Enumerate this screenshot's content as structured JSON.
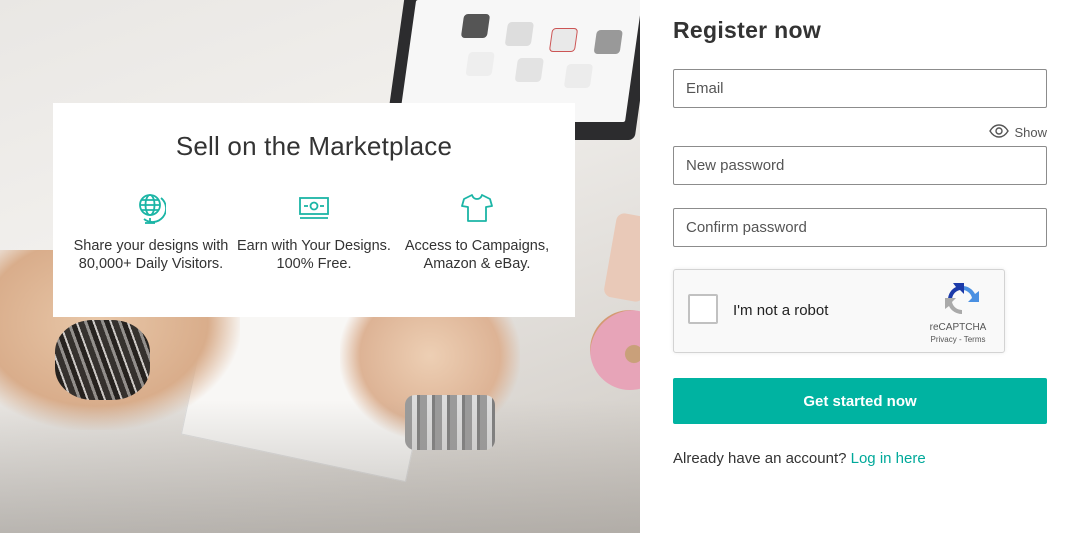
{
  "hero": {
    "card": {
      "title": "Sell on the Marketplace",
      "features": [
        {
          "icon": "globe-icon",
          "text": "Share your designs with 80,000+ Daily Visitors."
        },
        {
          "icon": "money-bill-icon",
          "text": "Earn with Your Designs. 100% Free."
        },
        {
          "icon": "tshirt-icon",
          "text": "Access to Campaigns, Amazon & eBay."
        }
      ]
    }
  },
  "register": {
    "title": "Register now",
    "email_placeholder": "Email",
    "show_label": "Show",
    "new_password_placeholder": "New password",
    "confirm_password_placeholder": "Confirm password",
    "captcha": {
      "label": "I'm not a robot",
      "brand": "reCAPTCHA",
      "privacy": "Privacy",
      "separator": " - ",
      "terms": "Terms"
    },
    "submit_label": "Get started now",
    "login_prompt": "Already have an account?",
    "login_link": "Log in here"
  },
  "colors": {
    "accent": "#00b3a1",
    "link": "#00a99a",
    "icon_teal": "#1bb5a6"
  }
}
